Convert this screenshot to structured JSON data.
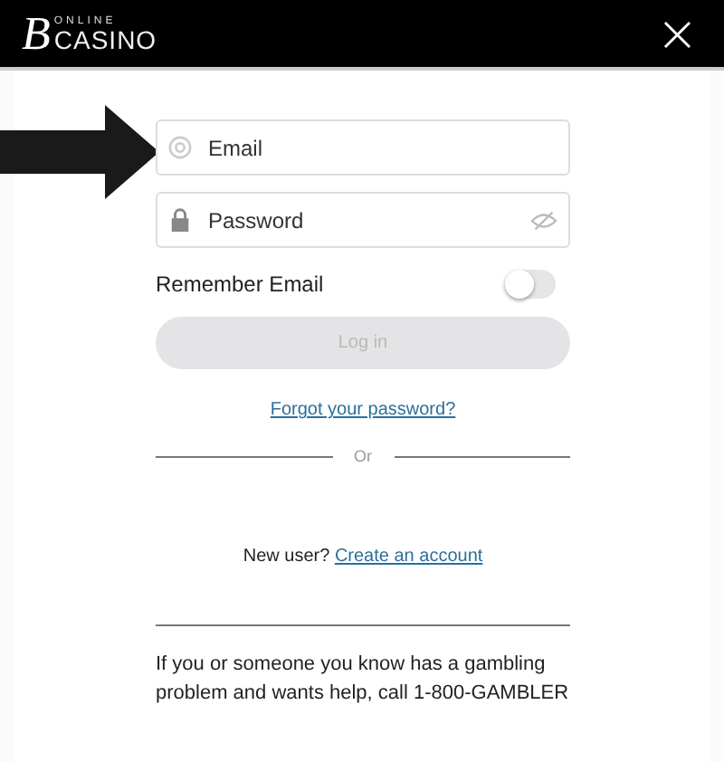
{
  "header": {
    "logo_mark": "B",
    "logo_top": "ONLINE",
    "logo_bottom": "CASINO",
    "close": "×"
  },
  "form": {
    "email": {
      "placeholder": "Email"
    },
    "password": {
      "placeholder": "Password"
    },
    "remember": {
      "label": "Remember Email",
      "on": false
    },
    "login": {
      "label": "Log in",
      "disabled": true
    },
    "forgot": "Forgot your password?",
    "divider": "Or",
    "new_user": {
      "text": "New user?",
      "link": "Create an account"
    },
    "disclaimer": "If you or someone you know has a gambling problem and wants help, call 1-800-GAMBLER"
  }
}
